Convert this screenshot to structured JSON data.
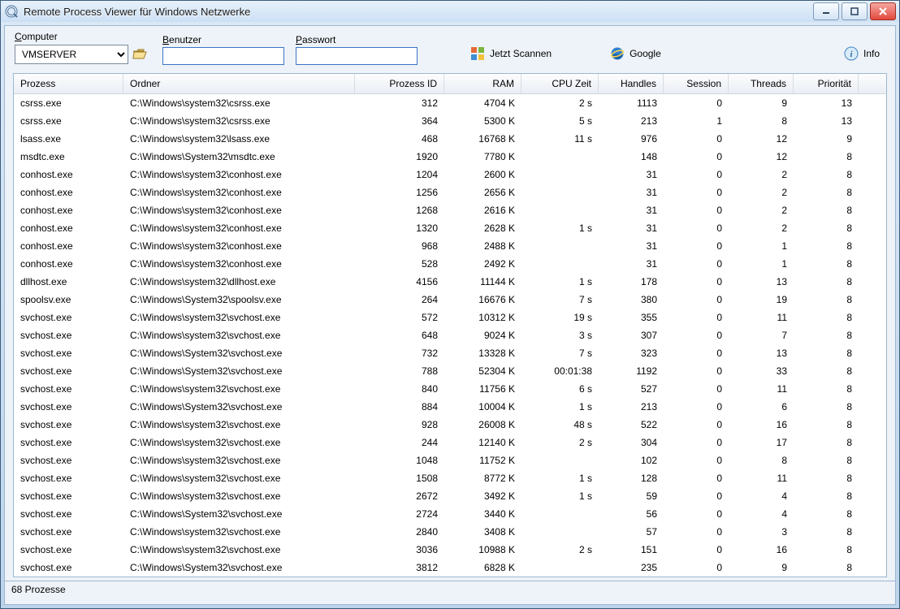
{
  "window": {
    "title": "Remote Process Viewer für Windows Netzwerke"
  },
  "toolbar": {
    "computer_label": "Computer",
    "computer_value": "VMSERVER",
    "user_label": "Benutzer",
    "user_value": "",
    "password_label": "Passwort",
    "password_value": "",
    "scan_label": "Jetzt Scannen",
    "google_label": "Google",
    "info_label": "Info"
  },
  "columns": [
    "Prozess",
    "Ordner",
    "Prozess ID",
    "RAM",
    "CPU Zeit",
    "Handles",
    "Session",
    "Threads",
    "Priorität"
  ],
  "rows": [
    {
      "p": "csrss.exe",
      "f": "C:\\Windows\\system32\\csrss.exe",
      "pid": "312",
      "ram": "4704 K",
      "cpu": "2 s",
      "h": "1113",
      "s": "0",
      "t": "9",
      "pr": "13"
    },
    {
      "p": "csrss.exe",
      "f": "C:\\Windows\\system32\\csrss.exe",
      "pid": "364",
      "ram": "5300 K",
      "cpu": "5 s",
      "h": "213",
      "s": "1",
      "t": "8",
      "pr": "13"
    },
    {
      "p": "lsass.exe",
      "f": "C:\\Windows\\system32\\lsass.exe",
      "pid": "468",
      "ram": "16768 K",
      "cpu": "11 s",
      "h": "976",
      "s": "0",
      "t": "12",
      "pr": "9"
    },
    {
      "p": "msdtc.exe",
      "f": "C:\\Windows\\System32\\msdtc.exe",
      "pid": "1920",
      "ram": "7780 K",
      "cpu": "",
      "h": "148",
      "s": "0",
      "t": "12",
      "pr": "8"
    },
    {
      "p": "conhost.exe",
      "f": "C:\\Windows\\system32\\conhost.exe",
      "pid": "1204",
      "ram": "2600 K",
      "cpu": "",
      "h": "31",
      "s": "0",
      "t": "2",
      "pr": "8"
    },
    {
      "p": "conhost.exe",
      "f": "C:\\Windows\\system32\\conhost.exe",
      "pid": "1256",
      "ram": "2656 K",
      "cpu": "",
      "h": "31",
      "s": "0",
      "t": "2",
      "pr": "8"
    },
    {
      "p": "conhost.exe",
      "f": "C:\\Windows\\system32\\conhost.exe",
      "pid": "1268",
      "ram": "2616 K",
      "cpu": "",
      "h": "31",
      "s": "0",
      "t": "2",
      "pr": "8"
    },
    {
      "p": "conhost.exe",
      "f": "C:\\Windows\\system32\\conhost.exe",
      "pid": "1320",
      "ram": "2628 K",
      "cpu": "1 s",
      "h": "31",
      "s": "0",
      "t": "2",
      "pr": "8"
    },
    {
      "p": "conhost.exe",
      "f": "C:\\Windows\\system32\\conhost.exe",
      "pid": "968",
      "ram": "2488 K",
      "cpu": "",
      "h": "31",
      "s": "0",
      "t": "1",
      "pr": "8"
    },
    {
      "p": "conhost.exe",
      "f": "C:\\Windows\\system32\\conhost.exe",
      "pid": "528",
      "ram": "2492 K",
      "cpu": "",
      "h": "31",
      "s": "0",
      "t": "1",
      "pr": "8"
    },
    {
      "p": "dllhost.exe",
      "f": "C:\\Windows\\system32\\dllhost.exe",
      "pid": "4156",
      "ram": "11144 K",
      "cpu": "1 s",
      "h": "178",
      "s": "0",
      "t": "13",
      "pr": "8"
    },
    {
      "p": "spoolsv.exe",
      "f": "C:\\Windows\\System32\\spoolsv.exe",
      "pid": "264",
      "ram": "16676 K",
      "cpu": "7 s",
      "h": "380",
      "s": "0",
      "t": "19",
      "pr": "8"
    },
    {
      "p": "svchost.exe",
      "f": "C:\\Windows\\system32\\svchost.exe",
      "pid": "572",
      "ram": "10312 K",
      "cpu": "19 s",
      "h": "355",
      "s": "0",
      "t": "11",
      "pr": "8"
    },
    {
      "p": "svchost.exe",
      "f": "C:\\Windows\\system32\\svchost.exe",
      "pid": "648",
      "ram": "9024 K",
      "cpu": "3 s",
      "h": "307",
      "s": "0",
      "t": "7",
      "pr": "8"
    },
    {
      "p": "svchost.exe",
      "f": "C:\\Windows\\System32\\svchost.exe",
      "pid": "732",
      "ram": "13328 K",
      "cpu": "7 s",
      "h": "323",
      "s": "0",
      "t": "13",
      "pr": "8"
    },
    {
      "p": "svchost.exe",
      "f": "C:\\Windows\\System32\\svchost.exe",
      "pid": "788",
      "ram": "52304 K",
      "cpu": "00:01:38",
      "h": "1192",
      "s": "0",
      "t": "33",
      "pr": "8"
    },
    {
      "p": "svchost.exe",
      "f": "C:\\Windows\\system32\\svchost.exe",
      "pid": "840",
      "ram": "11756 K",
      "cpu": "6 s",
      "h": "527",
      "s": "0",
      "t": "11",
      "pr": "8"
    },
    {
      "p": "svchost.exe",
      "f": "C:\\Windows\\System32\\svchost.exe",
      "pid": "884",
      "ram": "10004 K",
      "cpu": "1 s",
      "h": "213",
      "s": "0",
      "t": "6",
      "pr": "8"
    },
    {
      "p": "svchost.exe",
      "f": "C:\\Windows\\system32\\svchost.exe",
      "pid": "928",
      "ram": "26008 K",
      "cpu": "48 s",
      "h": "522",
      "s": "0",
      "t": "16",
      "pr": "8"
    },
    {
      "p": "svchost.exe",
      "f": "C:\\Windows\\system32\\svchost.exe",
      "pid": "244",
      "ram": "12140 K",
      "cpu": "2 s",
      "h": "304",
      "s": "0",
      "t": "17",
      "pr": "8"
    },
    {
      "p": "svchost.exe",
      "f": "C:\\Windows\\system32\\svchost.exe",
      "pid": "1048",
      "ram": "11752 K",
      "cpu": "",
      "h": "102",
      "s": "0",
      "t": "8",
      "pr": "8"
    },
    {
      "p": "svchost.exe",
      "f": "C:\\Windows\\system32\\svchost.exe",
      "pid": "1508",
      "ram": "8772 K",
      "cpu": "1 s",
      "h": "128",
      "s": "0",
      "t": "11",
      "pr": "8"
    },
    {
      "p": "svchost.exe",
      "f": "C:\\Windows\\system32\\svchost.exe",
      "pid": "2672",
      "ram": "3492 K",
      "cpu": "1 s",
      "h": "59",
      "s": "0",
      "t": "4",
      "pr": "8"
    },
    {
      "p": "svchost.exe",
      "f": "C:\\Windows\\System32\\svchost.exe",
      "pid": "2724",
      "ram": "3440 K",
      "cpu": "",
      "h": "56",
      "s": "0",
      "t": "4",
      "pr": "8"
    },
    {
      "p": "svchost.exe",
      "f": "C:\\Windows\\system32\\svchost.exe",
      "pid": "2840",
      "ram": "3408 K",
      "cpu": "",
      "h": "57",
      "s": "0",
      "t": "3",
      "pr": "8"
    },
    {
      "p": "svchost.exe",
      "f": "C:\\Windows\\system32\\svchost.exe",
      "pid": "3036",
      "ram": "10988 K",
      "cpu": "2 s",
      "h": "151",
      "s": "0",
      "t": "16",
      "pr": "8"
    },
    {
      "p": "svchost.exe",
      "f": "C:\\Windows\\System32\\svchost.exe",
      "pid": "3812",
      "ram": "6828 K",
      "cpu": "",
      "h": "235",
      "s": "0",
      "t": "9",
      "pr": "8"
    }
  ],
  "status": {
    "text": "68 Prozesse"
  }
}
